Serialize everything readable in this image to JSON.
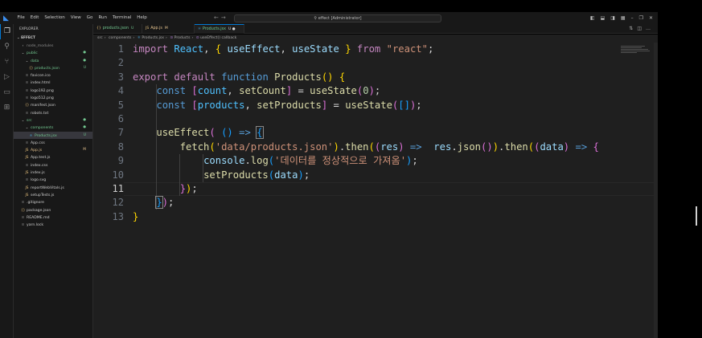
{
  "titlebar": {
    "menu": [
      "File",
      "Edit",
      "Selection",
      "View",
      "Go",
      "Run",
      "Terminal",
      "Help"
    ],
    "search": "effect [Administrator]"
  },
  "activitybar": {
    "icons": [
      "explorer-icon",
      "search-icon",
      "source-control-icon",
      "run-debug-icon",
      "remote-explorer-icon",
      "extensions-icon"
    ]
  },
  "sidebar": {
    "title": "EXPLORER",
    "root": "EFFECT",
    "tree": [
      {
        "label": "node_modules",
        "type": "folder",
        "depth": 1,
        "color": "gray",
        "badge": ""
      },
      {
        "label": "public",
        "type": "folder",
        "depth": 1,
        "color": "green",
        "badge": "●"
      },
      {
        "label": "data",
        "type": "folder",
        "depth": 2,
        "color": "green",
        "badge": "●"
      },
      {
        "label": "products.json",
        "type": "json",
        "depth": 3,
        "color": "green",
        "badge": "U"
      },
      {
        "label": "favicon.ico",
        "type": "file",
        "depth": 2,
        "color": "folder",
        "badge": ""
      },
      {
        "label": "index.html",
        "type": "file",
        "depth": 2,
        "color": "folder",
        "badge": ""
      },
      {
        "label": "logo192.png",
        "type": "file",
        "depth": 2,
        "color": "folder",
        "badge": ""
      },
      {
        "label": "logo512.png",
        "type": "file",
        "depth": 2,
        "color": "folder",
        "badge": ""
      },
      {
        "label": "manifest.json",
        "type": "json",
        "depth": 2,
        "color": "folder",
        "badge": ""
      },
      {
        "label": "robots.txt",
        "type": "file",
        "depth": 2,
        "color": "folder",
        "badge": ""
      },
      {
        "label": "src",
        "type": "folder",
        "depth": 1,
        "color": "green",
        "badge": "●"
      },
      {
        "label": "components",
        "type": "folder",
        "depth": 2,
        "color": "green",
        "badge": "●"
      },
      {
        "label": "Products.jsx",
        "type": "jsx",
        "depth": 3,
        "color": "green",
        "badge": "U",
        "selected": true
      },
      {
        "label": "App.css",
        "type": "file",
        "depth": 2,
        "color": "folder",
        "badge": ""
      },
      {
        "label": "App.js",
        "type": "js",
        "depth": 2,
        "color": "yellow",
        "badge": "M"
      },
      {
        "label": "App.test.js",
        "type": "js",
        "depth": 2,
        "color": "folder",
        "badge": ""
      },
      {
        "label": "index.css",
        "type": "file",
        "depth": 2,
        "color": "folder",
        "badge": ""
      },
      {
        "label": "index.js",
        "type": "js",
        "depth": 2,
        "color": "folder",
        "badge": ""
      },
      {
        "label": "logo.svg",
        "type": "file",
        "depth": 2,
        "color": "folder",
        "badge": ""
      },
      {
        "label": "reportWebVitals.js",
        "type": "js",
        "depth": 2,
        "color": "folder",
        "badge": ""
      },
      {
        "label": "setupTests.js",
        "type": "js",
        "depth": 2,
        "color": "folder",
        "badge": ""
      },
      {
        "label": ".gitignore",
        "type": "file",
        "depth": 1,
        "color": "folder",
        "badge": ""
      },
      {
        "label": "package.json",
        "type": "json",
        "depth": 1,
        "color": "folder",
        "badge": ""
      },
      {
        "label": "README.md",
        "type": "file",
        "depth": 1,
        "color": "folder",
        "badge": ""
      },
      {
        "label": "yarn.lock",
        "type": "file",
        "depth": 1,
        "color": "folder",
        "badge": ""
      }
    ]
  },
  "tabs": [
    {
      "label": "products.json",
      "status": "U",
      "active": false
    },
    {
      "label": "App.js",
      "status": "M",
      "active": false
    },
    {
      "label": "Products.jsx",
      "status": "U ●",
      "active": true
    }
  ],
  "breadcrumb": [
    "src",
    "components",
    "Products.jsx",
    "Products",
    "useEffect() callback"
  ],
  "editor": {
    "line_numbers": [
      "1",
      "2",
      "3",
      "4",
      "5",
      "6",
      "7",
      "8",
      "9",
      "10",
      "11",
      "12",
      "13"
    ],
    "current_line": 11
  },
  "colors": {
    "accent": "#0078d4",
    "editor_bg": "#1f1f1f",
    "sidebar_bg": "#181818"
  }
}
